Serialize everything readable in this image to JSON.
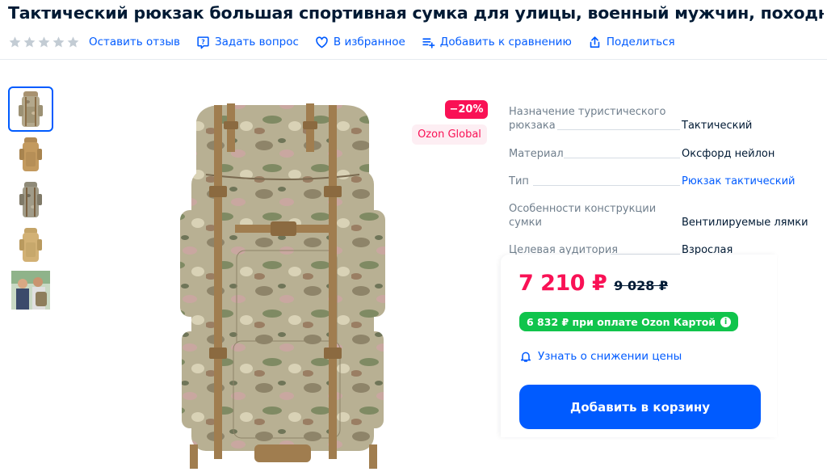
{
  "product": {
    "title": "Тактический рюкзак большая спортивная сумка для улицы, военный мужчин, походный"
  },
  "actions": {
    "rating_stars": 5,
    "review": "Оставить отзыв",
    "question": "Задать вопрос",
    "favorite": "В избранное",
    "compare": "Добавить к сравнению",
    "share": "Поделиться"
  },
  "badges": {
    "discount": "−20%",
    "seller": "Ozon Global"
  },
  "specs": [
    {
      "key": "Назначение туристического рюкзака",
      "value": "Тактический"
    },
    {
      "key": "Материал",
      "value": "Оксфорд нейлон"
    },
    {
      "key": "Тип",
      "value": "Рюкзак тактический"
    },
    {
      "key": "Особенности конструкции сумки",
      "value": "Вентилируемые лямки"
    },
    {
      "key": "Целевая аудитория",
      "value": "Взрослая"
    }
  ],
  "price": {
    "current": "7 210 ₽",
    "old": "9 028 ₽",
    "card_offer": "6 832 ₽ при оплате Ozon Картой",
    "notify": "Узнать о снижении цены",
    "add_to_cart": "Добавить в корзину"
  },
  "colors": {
    "accent": "#005bff",
    "price": "#f91155",
    "card_green": "#10c44c"
  }
}
